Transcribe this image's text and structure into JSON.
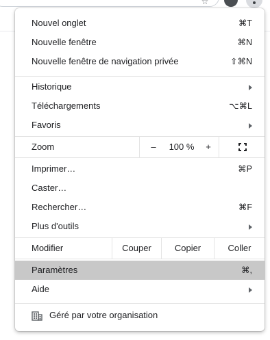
{
  "browser": {
    "icons": {
      "bookmark": "star-icon",
      "profile": "avatar",
      "menu": "three-dots-vertical-icon"
    }
  },
  "menu": {
    "section1": [
      {
        "label": "Nouvel onglet",
        "shortcut": "⌘T"
      },
      {
        "label": "Nouvelle fenêtre",
        "shortcut": "⌘N"
      },
      {
        "label": "Nouvelle fenêtre de navigation privée",
        "shortcut": "⇧⌘N"
      }
    ],
    "section2": [
      {
        "label": "Historique",
        "submenu": true
      },
      {
        "label": "Téléchargements",
        "shortcut": "⌥⌘L"
      },
      {
        "label": "Favoris",
        "submenu": true
      }
    ],
    "zoom": {
      "label": "Zoom",
      "minus": "–",
      "level": "100 %",
      "plus": "+",
      "fullscreen_icon": "fullscreen-icon"
    },
    "section3": [
      {
        "label": "Imprimer…",
        "shortcut": "⌘P"
      },
      {
        "label": "Caster…",
        "shortcut": ""
      },
      {
        "label": "Rechercher…",
        "shortcut": "⌘F"
      },
      {
        "label": "Plus d'outils",
        "submenu": true
      }
    ],
    "edit": {
      "label": "Modifier",
      "cut": "Couper",
      "copy": "Copier",
      "paste": "Coller"
    },
    "section4": [
      {
        "label": "Paramètres",
        "shortcut": "⌘,",
        "selected": true
      },
      {
        "label": "Aide",
        "submenu": true
      }
    ],
    "managed": {
      "label": "Géré par votre organisation",
      "icon": "building-icon"
    }
  },
  "colors": {
    "highlight": "#c8c8c8",
    "separator": "#e3e3e3",
    "text": "#202124"
  }
}
